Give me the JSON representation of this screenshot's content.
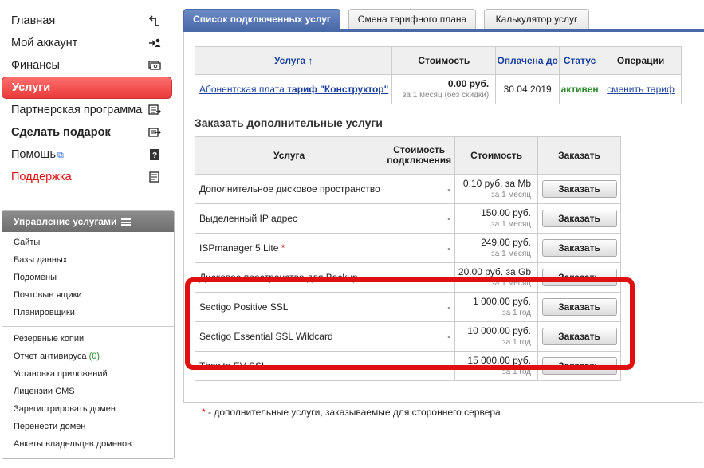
{
  "sidebar": {
    "menu": [
      {
        "label": "Главная",
        "icon": "home-arrow-icon"
      },
      {
        "label": "Мой аккаунт",
        "icon": "account-arrow-icon"
      },
      {
        "label": "Финансы",
        "icon": "money-icon"
      },
      {
        "label": "Услуги",
        "icon": "services-icon"
      },
      {
        "label": "Партнерская программа",
        "icon": "partner-icon"
      },
      {
        "label": "Сделать подарок",
        "icon": "gift-icon"
      },
      {
        "label": "Помощь",
        "icon": "help-icon"
      },
      {
        "label": "Поддержка",
        "icon": "support-icon"
      }
    ],
    "services_panel": {
      "title": "Управление услугами",
      "group1": [
        "Сайты",
        "Базы данных",
        "Подомены",
        "Почтовые ящики",
        "Планировщики"
      ],
      "group2": [
        "Резервные копии",
        "Отчет антивируса",
        "Установка приложений",
        "Лицензии CMS",
        "Зарегистрировать домен",
        "Перенести домен",
        "Анкеты владельцев доменов"
      ],
      "antivirus_count": "(0)"
    }
  },
  "tabs": [
    "Список подключенных услуг",
    "Смена тарифного плана",
    "Калькулятор услуг"
  ],
  "subscriptions": {
    "headers": {
      "service": "Услуга ↑",
      "cost": "Стоимость",
      "paid_until": "Оплачена до",
      "status": "Статус",
      "operations": "Операции"
    },
    "row": {
      "name_prefix": "Абонентская плата ",
      "name_bold": "тариф \"Конструктор\"",
      "price": "0.00 руб.",
      "price_note": "за 1 месяц (без скидки)",
      "paid_until": "30.04.2019",
      "status": "активен",
      "operation": "сменить тариф"
    }
  },
  "order": {
    "title": "Заказать дополнительные услуги",
    "headers": {
      "service": "Услуга",
      "connect_cost": "Стоимость подключения",
      "cost": "Стоимость",
      "order": "Заказать"
    },
    "rows": [
      {
        "name": "Дополнительное дисковое пространство",
        "connect": "-",
        "price": "0.10 руб. за Mb",
        "period": "за 1 месяц"
      },
      {
        "name": "Выделенный IP адрес",
        "connect": "-",
        "price": "150.00 руб.",
        "period": "за 1 месяц"
      },
      {
        "name": "ISPmanager 5 Lite",
        "connect": "-",
        "price": "249.00 руб.",
        "period": "за 1 месяц",
        "star": "*"
      },
      {
        "name": "Дисковое пространство для Backup",
        "connect": "-",
        "price": "20.00 руб. за Gb",
        "period": "за 1 месяц"
      },
      {
        "name": "Sectigo Positive SSL",
        "connect": "-",
        "price": "1 000.00 руб.",
        "period": "за 1 год"
      },
      {
        "name": "Sectigo Essential SSL Wildcard",
        "connect": "-",
        "price": "10 000.00 руб.",
        "period": "за 1 год"
      },
      {
        "name": "Thawte EV SSL",
        "connect": "-",
        "price": "15 000.00 руб.",
        "period": "за 1 год"
      }
    ],
    "button_label": "Заказать"
  },
  "footnote": {
    "star": "*",
    "text": " - дополнительные услуги, заказываемые для стороннего сервера"
  },
  "colors": {
    "active_tab": "#4a69a8",
    "active_menu": "#e93a3a",
    "highlight": "#e01010",
    "status_active": "#2a8a2a"
  }
}
